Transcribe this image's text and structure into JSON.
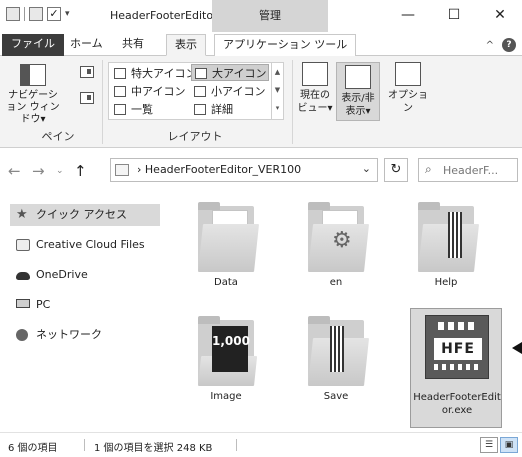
{
  "window": {
    "title": "HeaderFooterEdito...",
    "context_tab": "管理",
    "minimize": "—",
    "maximize": "☐",
    "close": "✕"
  },
  "ribbon_tabs": [
    "ファイル",
    "ホーム",
    "共有",
    "表示",
    "アプリケーション ツール"
  ],
  "ribbon": {
    "nav_pane_label": "ナビゲーション ウィンドウ▾",
    "pane_group_label": "ペイン",
    "layout_items": [
      "特大アイコン",
      "大アイコン",
      "中アイコン",
      "小アイコン",
      "一覧",
      "詳細"
    ],
    "layout_group_label": "レイアウト",
    "current_view_label": "現在の ビュー▾",
    "show_hide_label": "表示/非 表示▾",
    "options_label": "オプション"
  },
  "address": {
    "path": "HeaderFooterEditor_VER100",
    "search_placeholder": "HeaderF..."
  },
  "sidebar": {
    "items": [
      "クイック アクセス",
      "Creative Cloud Files",
      "OneDrive",
      "PC",
      "ネットワーク"
    ]
  },
  "files": [
    "Data",
    "en",
    "Help",
    "Image",
    "Save",
    "HeaderFooterEditor.exe"
  ],
  "cover_text": "1,000",
  "exe_icon_text": "HFE",
  "status": {
    "count": "6 個の項目",
    "selection": "1 個の項目を選択 248 KB"
  }
}
